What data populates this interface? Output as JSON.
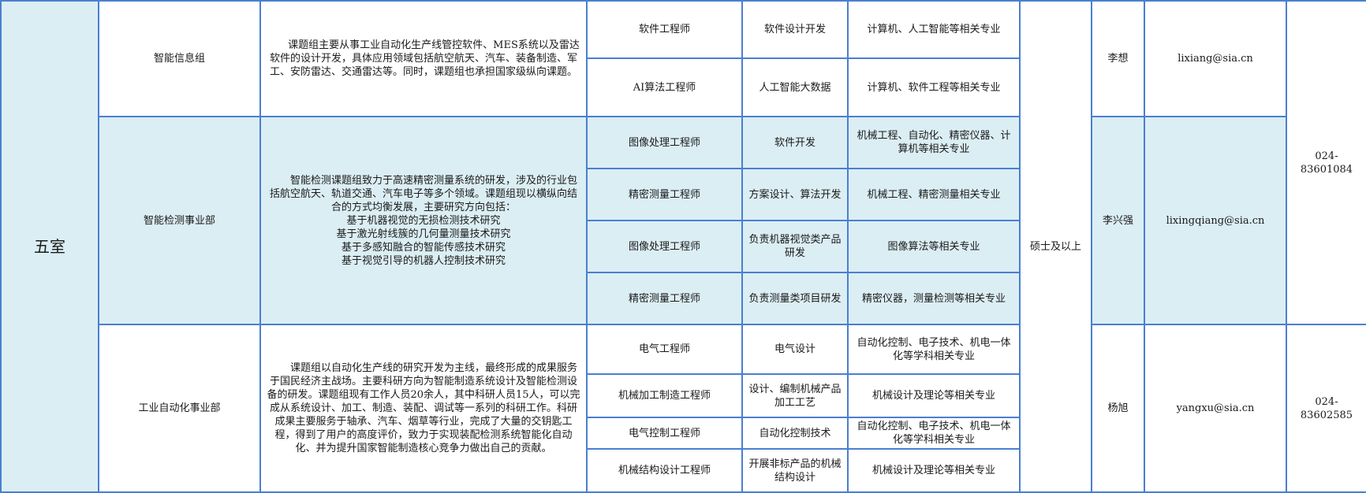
{
  "department": "五室",
  "degree": "硕士及以上",
  "groups": [
    {
      "name": "智能信息组",
      "description": [
        "课题组主要从事工业自动化生产线管控软件、MES系统以及雷达软件的设计开发，具体应用领域包括航空航天、汽车、装备制造、军工、安防雷达、交通雷达等。同时，课题组也承担国家级纵向课题。"
      ],
      "contact": "李想",
      "email": "lixiang@sia.cn",
      "positions": [
        {
          "title": "软件工程师",
          "duty": "软件设计开发",
          "major": "计算机、人工智能等相关专业"
        },
        {
          "title": "AI算法工程师",
          "duty": "人工智能大数据",
          "major": "计算机、软件工程等相关专业"
        }
      ]
    },
    {
      "name": "智能检测事业部",
      "description": [
        "智能检测课题组致力于高速精密测量系统的研发，涉及的行业包括航空航天、轨道交通、汽车电子等多个领域。课题组现以横纵向结合的方式均衡发展，主要研究方向包括：",
        "基于机器视觉的无损检测技术研究",
        "基于激光射线簇的几何量测量技术研究",
        "基于多感知融合的智能传感技术研究",
        "基于视觉引导的机器人控制技术研究"
      ],
      "contact": "李兴强",
      "email": "lixingqiang@sia.cn",
      "positions": [
        {
          "title": "图像处理工程师",
          "duty": "软件开发",
          "major": "机械工程、自动化、精密仪器、计算机等相关专业"
        },
        {
          "title": "精密测量工程师",
          "duty": "方案设计、算法开发",
          "major": "机械工程、精密测量相关专业"
        },
        {
          "title": "图像处理工程师",
          "duty": "负责机器视觉类产品研发",
          "major": "图像算法等相关专业"
        },
        {
          "title": "精密测量工程师",
          "duty": "负责测量类项目研发",
          "major": "精密仪器，测量检测等相关专业"
        }
      ]
    },
    {
      "name": "工业自动化事业部",
      "description": [
        "课题组以自动化生产线的研究开发为主线，最终形成的成果服务于国民经济主战场。主要科研方向为智能制造系统设计及智能检测设备的研发。课题组现有工作人员20余人，其中科研人员15人，可以完成从系统设计、加工、制造、装配、调试等一系列的科研工作。科研成果主要服务于轴承、汽车、烟草等行业，完成了大量的交钥匙工程，得到了用户的高度评价，致力于实现装配检测系统智能化自动化、并为提升国家智能制造核心竞争力做出自己的贡献。"
      ],
      "contact": "杨旭",
      "email": "yangxu@sia.cn",
      "positions": [
        {
          "title": "电气工程师",
          "duty": "电气设计",
          "major": "自动化控制、电子技术、机电一体化等学科相关专业"
        },
        {
          "title": "机械加工制造工程师",
          "duty": "设计、编制机械产品加工工艺",
          "major": "机械设计及理论等相关专业"
        },
        {
          "title": "电气控制工程师",
          "duty": "自动化控制技术",
          "major": "自动化控制、电子技术、机电一体化等学科相关专业"
        },
        {
          "title": "机械结构设计工程师",
          "duty": "开展非标产品的机械结构设计",
          "major": "机械设计及理论等相关专业"
        }
      ]
    }
  ],
  "phones": [
    "024-83601084",
    "024-83602585"
  ],
  "colors": {
    "border": "#4a7fd0",
    "highlight": "#dbeef4"
  }
}
